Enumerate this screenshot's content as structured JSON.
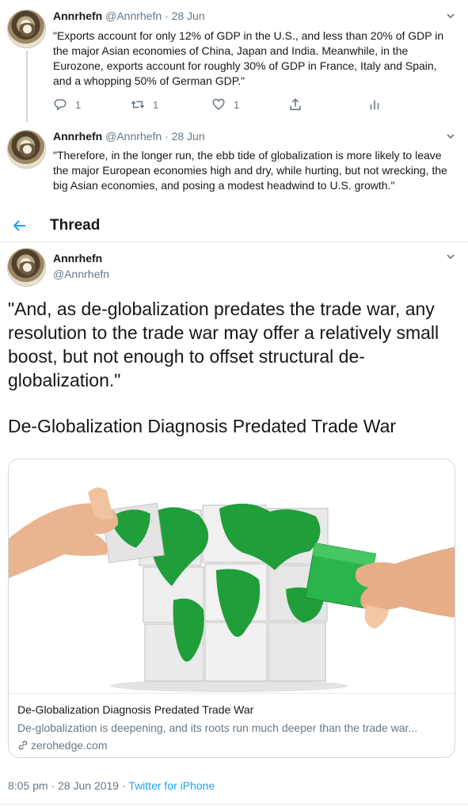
{
  "tweets": [
    {
      "name": "Annrhefn",
      "handle": "@Annrhefn",
      "date": "· 28 Jun",
      "text": "\"Exports account for only 12% of GDP in the U.S., and less than 20% of GDP in the major Asian economies of China, Japan and India. Meanwhile, in the Eurozone, exports account for roughly 30% of GDP in France, Italy and Spain, and a whopping 50% of German GDP.\"",
      "replies": "1",
      "retweets": "1",
      "likes": "1"
    },
    {
      "name": "Annrhefn",
      "handle": "@Annrhefn",
      "date": "· 28 Jun",
      "text": "\"Therefore, in the longer run, the ebb tide of globalization is more likely to leave the major European economies high and dry, while hurting, but not wrecking, the big Asian economies, and posing a modest headwind to U.S. growth.\""
    }
  ],
  "thread_bar": {
    "title": "Thread"
  },
  "main_tweet": {
    "name": "Annrhefn",
    "handle": "@Annrhefn",
    "text": "\"And, as de-globalization predates the trade war, any resolution to the trade war may offer a relatively small boost, but not enough to offset structural de-globalization.\"",
    "title_line": "De-Globalization Diagnosis Predated Trade War",
    "card": {
      "title": "De-Globalization Diagnosis Predated Trade War",
      "description": "De-globalization is deepening, and its roots run much deeper than the trade war...",
      "domain": "zerohedge.com"
    },
    "time": "8:05 pm · 28 Jun 2019 ·",
    "source": "Twitter for iPhone"
  },
  "icons": {
    "reply": "reply-icon",
    "retweet": "retweet-icon",
    "like": "heart-icon",
    "share": "share-icon",
    "analytics": "analytics-icon",
    "back": "back-arrow-icon",
    "link": "link-icon",
    "more": "chevron-down-icon"
  },
  "colors": {
    "accent": "#1da1f2",
    "secondary_text": "#657786",
    "card_green": "#1f9e3a"
  }
}
